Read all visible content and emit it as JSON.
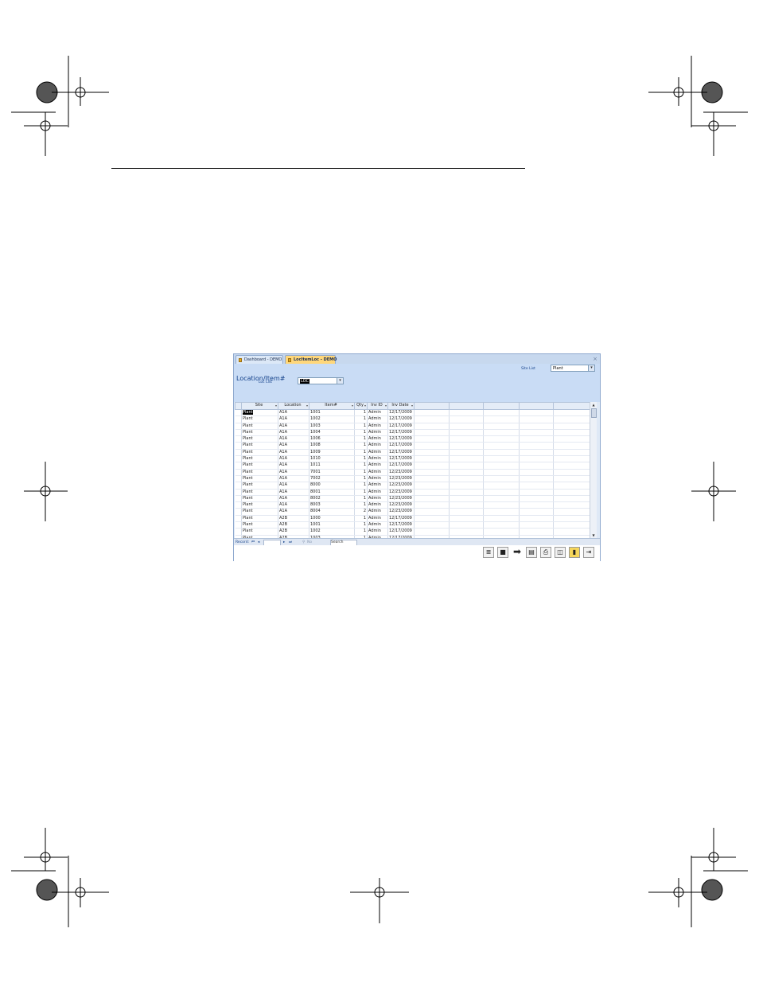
{
  "tabs": [
    {
      "label": "Dashboard - DEMO"
    },
    {
      "label": "LocItemLoc - DEMO"
    }
  ],
  "form": {
    "title": "Location/Item#",
    "site_list_label": "Site List",
    "site_list_value": "Plant",
    "loc_list_label": "Loc List",
    "loc_list_value": "LOC"
  },
  "grid": {
    "columns": [
      "Site",
      "Location",
      "Item#",
      "Qty",
      "Inv ID",
      "Inv Date"
    ],
    "rows": [
      [
        "Plant",
        "A1A",
        "1001",
        "1",
        "Admin",
        "12/17/2009"
      ],
      [
        "Plant",
        "A1A",
        "1002",
        "1",
        "Admin",
        "12/17/2009"
      ],
      [
        "Plant",
        "A1A",
        "1003",
        "1",
        "Admin",
        "12/17/2009"
      ],
      [
        "Plant",
        "A1A",
        "1004",
        "1",
        "Admin",
        "12/17/2009"
      ],
      [
        "Plant",
        "A1A",
        "1006",
        "1",
        "Admin",
        "12/17/2009"
      ],
      [
        "Plant",
        "A1A",
        "1008",
        "1",
        "Admin",
        "12/17/2009"
      ],
      [
        "Plant",
        "A1A",
        "1009",
        "1",
        "Admin",
        "12/17/2009"
      ],
      [
        "Plant",
        "A1A",
        "1010",
        "1",
        "Admin",
        "12/17/2009"
      ],
      [
        "Plant",
        "A1A",
        "1011",
        "1",
        "Admin",
        "12/17/2009"
      ],
      [
        "Plant",
        "A1A",
        "7001",
        "1",
        "Admin",
        "12/23/2009"
      ],
      [
        "Plant",
        "A1A",
        "7002",
        "1",
        "Admin",
        "12/23/2009"
      ],
      [
        "Plant",
        "A1A",
        "8000",
        "1",
        "Admin",
        "12/23/2009"
      ],
      [
        "Plant",
        "A1A",
        "8001",
        "1",
        "Admin",
        "12/23/2009"
      ],
      [
        "Plant",
        "A1A",
        "8002",
        "1",
        "Admin",
        "12/23/2009"
      ],
      [
        "Plant",
        "A1A",
        "8003",
        "1",
        "Admin",
        "12/23/2009"
      ],
      [
        "Plant",
        "A1A",
        "8004",
        "2",
        "Admin",
        "12/23/2009"
      ],
      [
        "Plant",
        "A2B",
        "1000",
        "1",
        "Admin",
        "12/17/2009"
      ],
      [
        "Plant",
        "A2B",
        "1001",
        "1",
        "Admin",
        "12/17/2009"
      ],
      [
        "Plant",
        "A2B",
        "1002",
        "1",
        "Admin",
        "12/17/2009"
      ],
      [
        "Plant",
        "A2B",
        "1003",
        "1",
        "Admin",
        "12/17/2009"
      ]
    ]
  },
  "navbar": {
    "record_label": "Record:",
    "filter_label": "No Filter",
    "search_label": "Search"
  },
  "footer_buttons": [
    "list-icon",
    "stop-icon",
    "arrow-right-icon",
    "report-icon",
    "print-icon",
    "preview-icon",
    "trash-icon",
    "exit-icon"
  ],
  "colors": {
    "accent": "#15428b",
    "active_tab": "#ffd77a"
  }
}
